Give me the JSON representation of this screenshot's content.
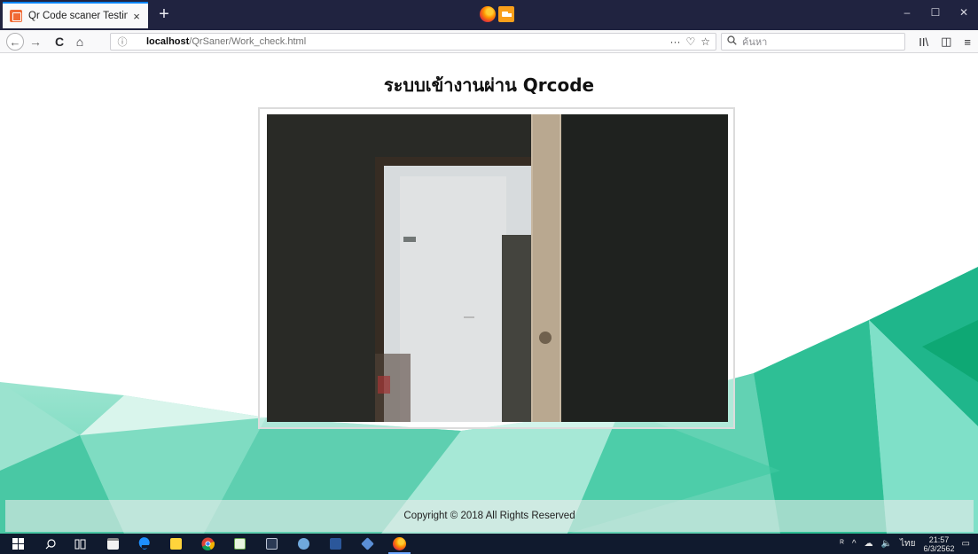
{
  "browser": {
    "tab_title": "Qr Code scaner Testing",
    "tab_close": "×",
    "new_tab": "+",
    "url_host": "localhost",
    "url_path": "/QrSaner/Work_check.html",
    "url_info_glyph": "ⓘ",
    "url_more": "···",
    "url_pocket": "♡",
    "url_star": "☆",
    "search_placeholder": "ค้นหา",
    "window_controls": [
      "–",
      "☐",
      "✕"
    ]
  },
  "nav": {
    "back": "←",
    "forward": "→",
    "reload": "C",
    "home": "⌂",
    "library": "II\\",
    "sidebar": "◫",
    "menu": "≡"
  },
  "page": {
    "title": "ระบบเข้างานผ่าน Qrcode",
    "footer": "Copyright © 2018 All Rights Reserved"
  },
  "taskbar": {
    "apps": [
      "windows",
      "search",
      "task-view",
      "store",
      "edge",
      "sticky-notes",
      "chrome",
      "notepad",
      "file-explorer",
      "steam",
      "word",
      "box",
      "firefox"
    ],
    "tray_people": "ᴿ",
    "tray_chevron": "^",
    "tray_wifi": "☁",
    "tray_volume": "🔈",
    "language": "ไทย",
    "time": "21:57",
    "date": "6/3/2562",
    "notifications": "▭"
  },
  "colors": {
    "tabbar": "#202340",
    "accent": "#0a84ff",
    "taskbar": "#101a2e",
    "teal_light": "#7fe0c8",
    "teal_dark": "#1fb68b"
  }
}
